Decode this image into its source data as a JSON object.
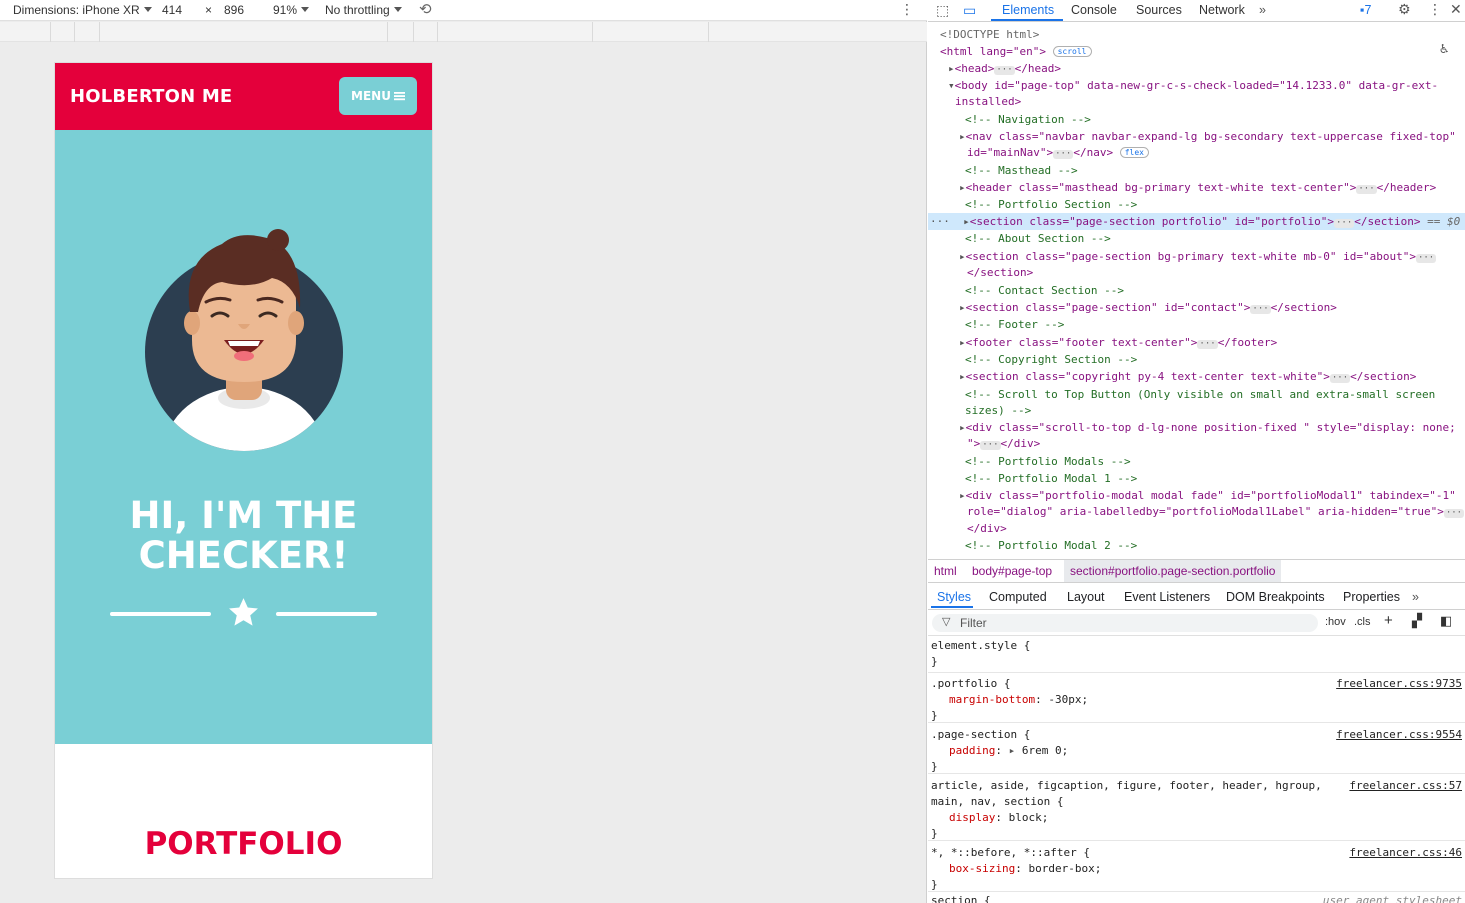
{
  "device_toolbar": {
    "dimensions_label": "Dimensions: iPhone XR",
    "width": "414",
    "times": "×",
    "height": "896",
    "zoom": "91%",
    "throttling": "No throttling"
  },
  "site": {
    "brand": "HOLBERTON ME",
    "menu_label": "MENU",
    "headline_line1": "HI, I'M THE",
    "headline_line2": "CHECKER!",
    "portfolio_title": "PORTFOLIO",
    "colors": {
      "primary": "#e4003b",
      "secondary": "#7acfd5",
      "avatar_bg": "#2c3e50"
    }
  },
  "devtools": {
    "tabs": [
      "Elements",
      "Console",
      "Sources",
      "Network"
    ],
    "issues_count": "7",
    "dom_lines": [
      "<!DOCTYPE html>",
      "<html lang=\"en\">",
      "<head>",
      "<body id=\"page-top\" data-new-gr-c-s-check-loaded=\"14.1233.0\" data-gr-ext-",
      "installed>",
      "<!-- Navigation -->",
      "<nav class=\"navbar navbar-expand-lg bg-secondary text-uppercase fixed-top\"",
      "id=\"mainNav\">",
      "<!-- Masthead -->",
      "<header class=\"masthead bg-primary text-white text-center\">",
      "<!-- Portfolio Section -->",
      "<section class=\"page-section portfolio\" id=\"portfolio\">",
      "<!-- About Section -->",
      "<section class=\"page-section bg-primary text-white mb-0\" id=\"about\">",
      "</section>",
      "<!-- Contact Section -->",
      "<section class=\"page-section\" id=\"contact\">",
      "<!-- Footer -->",
      "<footer class=\"footer text-center\">",
      "<!-- Copyright Section -->",
      "<section class=\"copyright py-4 text-center text-white\">",
      "<!-- Scroll to Top Button (Only visible on small and extra-small screen",
      "sizes) -->",
      "<div class=\"scroll-to-top d-lg-none position-fixed \" style=\"display: none;",
      "\">",
      "<!-- Portfolio Modals -->",
      "<!-- Portfolio Modal 1 -->",
      "<div class=\"portfolio-modal modal fade\" id=\"portfolioModal1\" tabindex=\"-1\"",
      "role=\"dialog\" aria-labelledby=\"portfolioModal1Label\" aria-hidden=\"true\">",
      "</div>",
      "<!-- Portfolio Modal 2 -->"
    ],
    "breadcrumbs": [
      "html",
      "body#page-top",
      "section#portfolio.page-section.portfolio"
    ],
    "sub_tabs": [
      "Styles",
      "Computed",
      "Layout",
      "Event Listeners",
      "DOM Breakpoints",
      "Properties"
    ],
    "filter_placeholder": "Filter",
    "filter_hov": ":hov",
    "filter_cls": ".cls",
    "styles": [
      {
        "selector": "element.style {",
        "props": [],
        "source": ""
      },
      {
        "selector": ".portfolio {",
        "props": [
          [
            "margin-bottom",
            "-30px;"
          ]
        ],
        "source": "freelancer.css:9735"
      },
      {
        "selector": ".page-section {",
        "props": [
          [
            "padding",
            "6rem 0;"
          ]
        ],
        "source": "freelancer.css:9554"
      },
      {
        "selector": "article, aside, figcaption, figure, footer, header, hgroup,",
        "selector2": "main, nav, section {",
        "props": [
          [
            "display",
            "block;"
          ]
        ],
        "source": "freelancer.css:57"
      },
      {
        "selector": "*, *::before, *::after {",
        "props": [
          [
            "box-sizing",
            "border-box;"
          ]
        ],
        "source": "freelancer.css:46"
      },
      {
        "selector": "section {",
        "props": [],
        "source": "user agent stylesheet"
      }
    ]
  }
}
